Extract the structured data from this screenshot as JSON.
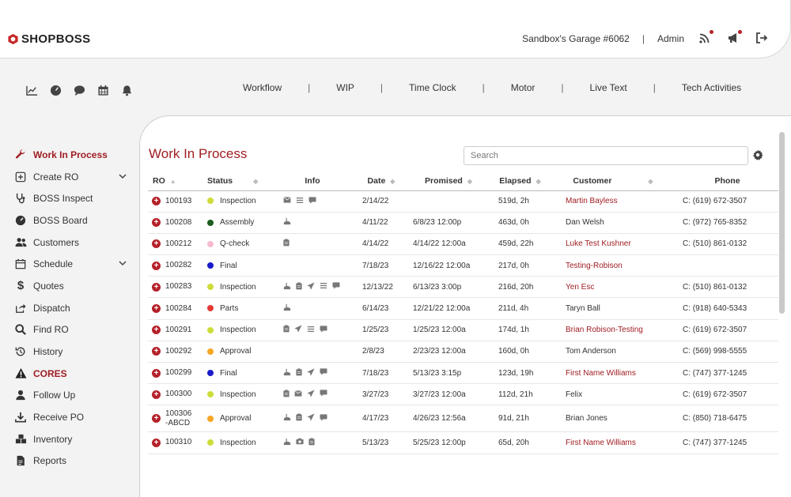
{
  "header": {
    "brand": "SHOPBOSS",
    "shop_name": "Sandbox's Garage #6062",
    "separator": "|",
    "user": "Admin",
    "colors": {
      "accent": "#9f1d22",
      "dot": "#b5212a"
    }
  },
  "toolbar_icons": [
    "chart-icon",
    "dashboard-gauge-icon",
    "chat-icon",
    "calendar-icon",
    "bell-icon"
  ],
  "topnav": {
    "items": [
      "Workflow",
      "WIP",
      "Time Clock",
      "Motor",
      "Live Text",
      "Tech Activities"
    ],
    "separator": "|"
  },
  "sidebar": {
    "items": [
      {
        "label": "Work In Process",
        "icon": "wrench-icon"
      },
      {
        "label": "Create RO",
        "icon": "plus-square-icon"
      },
      {
        "label": "BOSS Inspect",
        "icon": "stethoscope-icon"
      },
      {
        "label": "BOSS Board",
        "icon": "gauge-icon"
      },
      {
        "label": "Customers",
        "icon": "users-icon"
      },
      {
        "label": "Schedule",
        "icon": "calendar-icon"
      },
      {
        "label": "Quotes",
        "icon": "dollar-icon"
      },
      {
        "label": "Dispatch",
        "icon": "share-icon"
      },
      {
        "label": "Find RO",
        "icon": "search-icon"
      },
      {
        "label": "History",
        "icon": "history-icon"
      },
      {
        "label": "CORES",
        "icon": "warning-icon"
      },
      {
        "label": "Follow Up",
        "icon": "user-icon"
      },
      {
        "label": "Receive PO",
        "icon": "download-icon"
      },
      {
        "label": "Inventory",
        "icon": "boxes-icon"
      },
      {
        "label": "Reports",
        "icon": "report-icon"
      }
    ]
  },
  "main": {
    "title": "Work In Process",
    "search_placeholder": "Search",
    "columns": [
      "RO",
      "Status",
      "Info",
      "Date",
      "Promised",
      "Elapsed",
      "Customer",
      "Phone"
    ],
    "rows": [
      {
        "ro": "100193",
        "status": "Inspection",
        "status_color": "#cddc39",
        "info": [
          "envelope-icon",
          "list-icon",
          "comment-icon"
        ],
        "date": "2/14/22",
        "promised": "",
        "elapsed": "519d, 2h",
        "customer": "Martin Bayless",
        "customer_link": true,
        "phone": "C:  (619) 672-3507"
      },
      {
        "ro": "100208",
        "status": "Assembly",
        "status_color": "#1b5e20",
        "info": [
          "tech-icon"
        ],
        "date": "4/11/22",
        "promised": "6/8/23 12:00p",
        "elapsed": "463d, 0h",
        "customer": "Dan Welsh",
        "customer_link": false,
        "phone": "C:  (972) 765-8352"
      },
      {
        "ro": "100212",
        "status": "Q-check",
        "status_color": "#f8bbd0",
        "info": [
          "clipboard-icon"
        ],
        "date": "4/14/22",
        "promised": "4/14/22 12:00a",
        "elapsed": "459d, 22h",
        "customer": "Luke Test Kushner",
        "customer_link": true,
        "phone": "C:  (510) 861-0132"
      },
      {
        "ro": "100282",
        "status": "Final",
        "status_color": "#1a1acc",
        "info": [],
        "date": "7/18/23",
        "promised": "12/16/22 12:00a",
        "elapsed": "217d, 0h",
        "customer": "Testing-Robison",
        "customer_link": true,
        "phone": ""
      },
      {
        "ro": "100283",
        "status": "Inspection",
        "status_color": "#cddc39",
        "info": [
          "tech-icon",
          "clipboard-icon",
          "send-icon",
          "list-icon",
          "comment-icon"
        ],
        "date": "12/13/22",
        "promised": "6/13/23 3:00p",
        "elapsed": "216d, 20h",
        "customer": "Yen Esc",
        "customer_link": true,
        "phone": "C:  (510) 861-0132"
      },
      {
        "ro": "100284",
        "status": "Parts",
        "status_color": "#e53935",
        "info": [
          "tech-icon"
        ],
        "date": "6/14/23",
        "promised": "12/21/22 12:00a",
        "elapsed": "211d, 4h",
        "customer": "Taryn Ball",
        "customer_link": false,
        "phone": "C:  (918) 640-5343"
      },
      {
        "ro": "100291",
        "status": "Inspection",
        "status_color": "#cddc39",
        "info": [
          "clipboard-icon",
          "send-icon",
          "list-icon",
          "comment-icon"
        ],
        "date": "1/25/23",
        "promised": "1/25/23 12:00a",
        "elapsed": "174d, 1h",
        "customer": "Brian Robison-Testing",
        "customer_link": true,
        "phone": "C:  (619) 672-3507"
      },
      {
        "ro": "100292",
        "status": "Approval",
        "status_color": "#f5a623",
        "info": [],
        "date": "2/8/23",
        "promised": "2/23/23 12:00a",
        "elapsed": "160d, 0h",
        "customer": "Tom Anderson",
        "customer_link": false,
        "phone": "C:  (569) 998-5555"
      },
      {
        "ro": "100299",
        "status": "Final",
        "status_color": "#1a1acc",
        "info": [
          "tech-icon",
          "clipboard-icon",
          "send-icon",
          "comment-icon"
        ],
        "date": "7/18/23",
        "promised": "5/13/23 3:15p",
        "elapsed": "123d, 19h",
        "customer": "First Name Williams",
        "customer_link": true,
        "phone": "C:  (747) 377-1245"
      },
      {
        "ro": "100300",
        "status": "Inspection",
        "status_color": "#cddc39",
        "info": [
          "clipboard-icon",
          "envelope-icon",
          "send-icon",
          "comment-icon"
        ],
        "date": "3/27/23",
        "promised": "3/27/23 12:00a",
        "elapsed": "112d, 21h",
        "customer": "Felix",
        "customer_link": false,
        "phone": "C:  (619) 672-3507"
      },
      {
        "ro": "100306-ABCD",
        "status": "Approval",
        "status_color": "#f5a623",
        "info": [
          "tech-icon",
          "clipboard-icon",
          "send-icon",
          "comment-icon"
        ],
        "date": "4/17/23",
        "promised": "4/26/23 12:56a",
        "elapsed": "91d, 21h",
        "customer": "Brian Jones",
        "customer_link": false,
        "phone": "C:  (850) 718-6475"
      },
      {
        "ro": "100310",
        "status": "Inspection",
        "status_color": "#cddc39",
        "info": [
          "tech-icon",
          "camera-icon",
          "clipboard-icon"
        ],
        "date": "5/13/23",
        "promised": "5/25/23 12:00p",
        "elapsed": "65d, 20h",
        "customer": "First Name Williams",
        "customer_link": true,
        "phone": "C:  (747) 377-1245"
      }
    ]
  }
}
